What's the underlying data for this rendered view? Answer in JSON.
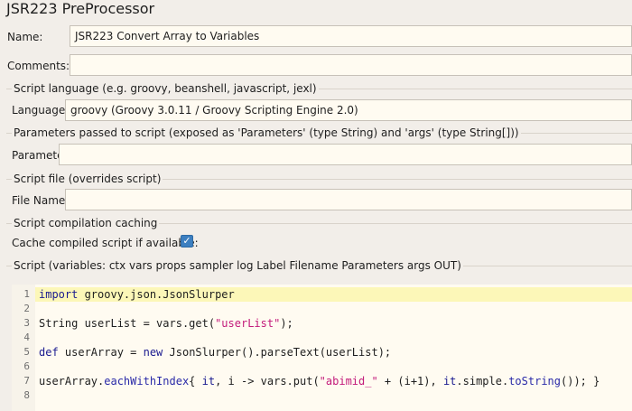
{
  "window": {
    "title": "JSR223 PreProcessor"
  },
  "fields": {
    "name_label": "Name:",
    "name_value": "JSR223 Convert Array to Variables",
    "comments_label": "Comments:",
    "comments_value": ""
  },
  "sections": {
    "script_language": {
      "title": "Script language (e.g. groovy, beanshell, javascript, jexl)",
      "label": "Language:",
      "value": "groovy     (Groovy 3.0.11 / Groovy Scripting Engine 2.0)"
    },
    "parameters": {
      "title": "Parameters passed to script (exposed as 'Parameters' (type String) and 'args' (type String[]))",
      "label": "Parameters:",
      "value": ""
    },
    "script_file": {
      "title": "Script file (overrides script)",
      "label": "File Name:",
      "value": ""
    },
    "compilation_cache": {
      "title": "Script compilation caching",
      "label": "Cache compiled script if available:",
      "checked": true,
      "check_glyph": "✓"
    },
    "script": {
      "title": "Script (variables: ctx vars props sampler log Label Filename Parameters args OUT)"
    }
  },
  "editor": {
    "line_numbers": [
      "1",
      "2",
      "3",
      "4",
      "5",
      "6",
      "7",
      "8"
    ],
    "lines": {
      "l1": {
        "kw": "import",
        "rest": " groovy.json.JsonSlurper"
      },
      "l3": {
        "t1": "String userList = vars.get(",
        "str": "\"userList\"",
        "t2": ");"
      },
      "l5": {
        "kw1": "def",
        "t1": " userArray = ",
        "kw2": "new",
        "t2": " JsonSlurper().parseText(userList);"
      },
      "l7": {
        "t1": "userArray.",
        "m1": "eachWithIndex",
        "t2": "{ ",
        "kw1": "it",
        "t3": ", i -> vars.put(",
        "str": "\"abimid_\"",
        "t4": " + (i+1), ",
        "kw2": "it",
        "t5": ".simple.",
        "m2": "toString",
        "t6": "()); }"
      }
    }
  }
}
